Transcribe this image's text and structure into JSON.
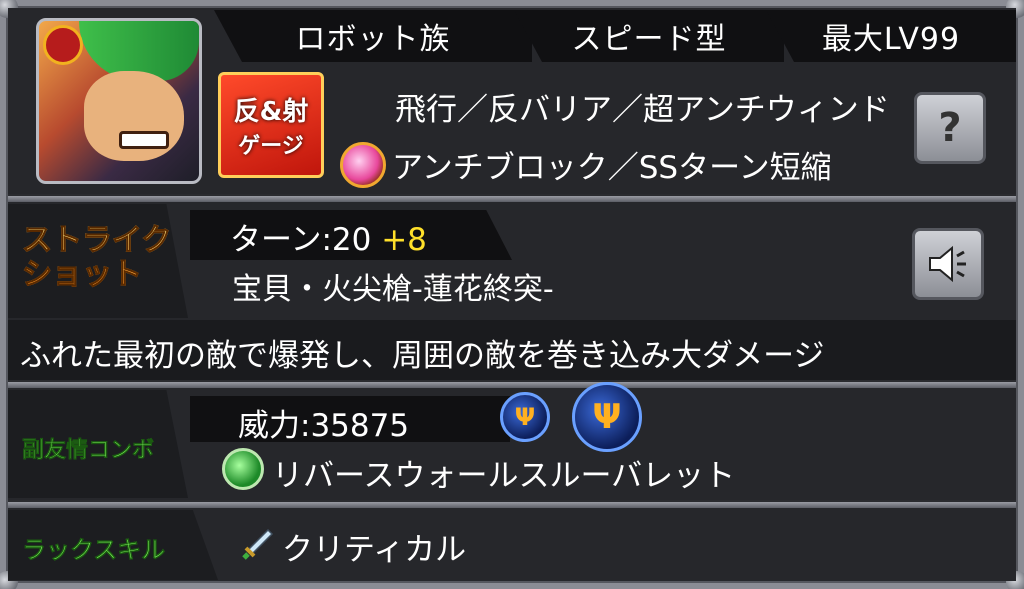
{
  "monster": {
    "tribe": "ロボット族",
    "type": "スピード型",
    "max_level": "最大LV99",
    "gauge_icon": {
      "line1": "反&射",
      "line2": "ゲージ"
    },
    "abilities_line1": "飛行／反バリア／超アンチウィンド",
    "abilities_line2": "アンチブロック／SSターン短縮",
    "help_icon": "question-icon"
  },
  "strike_shot": {
    "label": "ストライク\nショット",
    "turn_label": "ターン:20",
    "turn_plus": "+8",
    "name": "宝貝・火尖槍-蓮花終突-",
    "description": "ふれた最初の敵で爆発し、周囲の敵を巻き込み大ダメージ",
    "sound_icon": "speaker-icon"
  },
  "sub_combo": {
    "label": "副友情コンボ",
    "power": "威力:35875",
    "name": "リバースウォールスルーバレット"
  },
  "luck_skill": {
    "label": "ラックスキル",
    "name": "クリティカル"
  },
  "colors": {
    "accent_yellow": "#ffe02a",
    "label_green": "#7cf05a",
    "label_orange": "#ff8a1a"
  }
}
